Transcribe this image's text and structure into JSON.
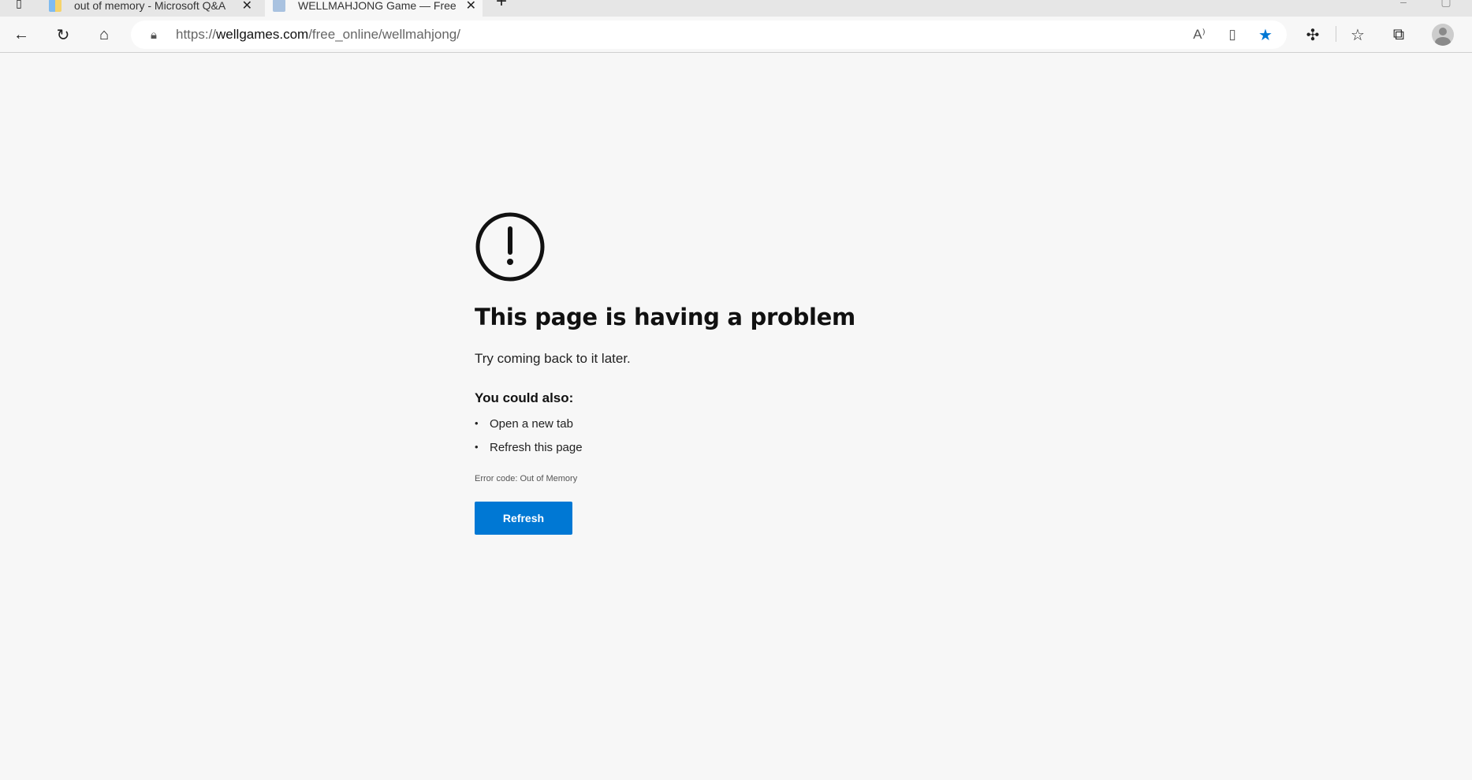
{
  "browser": {
    "tabs": [
      {
        "title": "out of memory - Microsoft Q&A",
        "active": false
      },
      {
        "title": "WELLMAHJONG Game — Free O",
        "active": true
      }
    ],
    "url_prefix": "https://",
    "url_domain": "wellgames.com",
    "url_path": "/free_online/wellmahjong/",
    "accent": "#0078d4"
  },
  "page": {
    "title": "This page is having a problem",
    "message": "Try coming back to it later.",
    "suggestions_heading": "You could also:",
    "suggestions": [
      "Open a new tab",
      "Refresh this page"
    ],
    "error_code": "Error code: Out of Memory",
    "refresh_label": "Refresh"
  }
}
